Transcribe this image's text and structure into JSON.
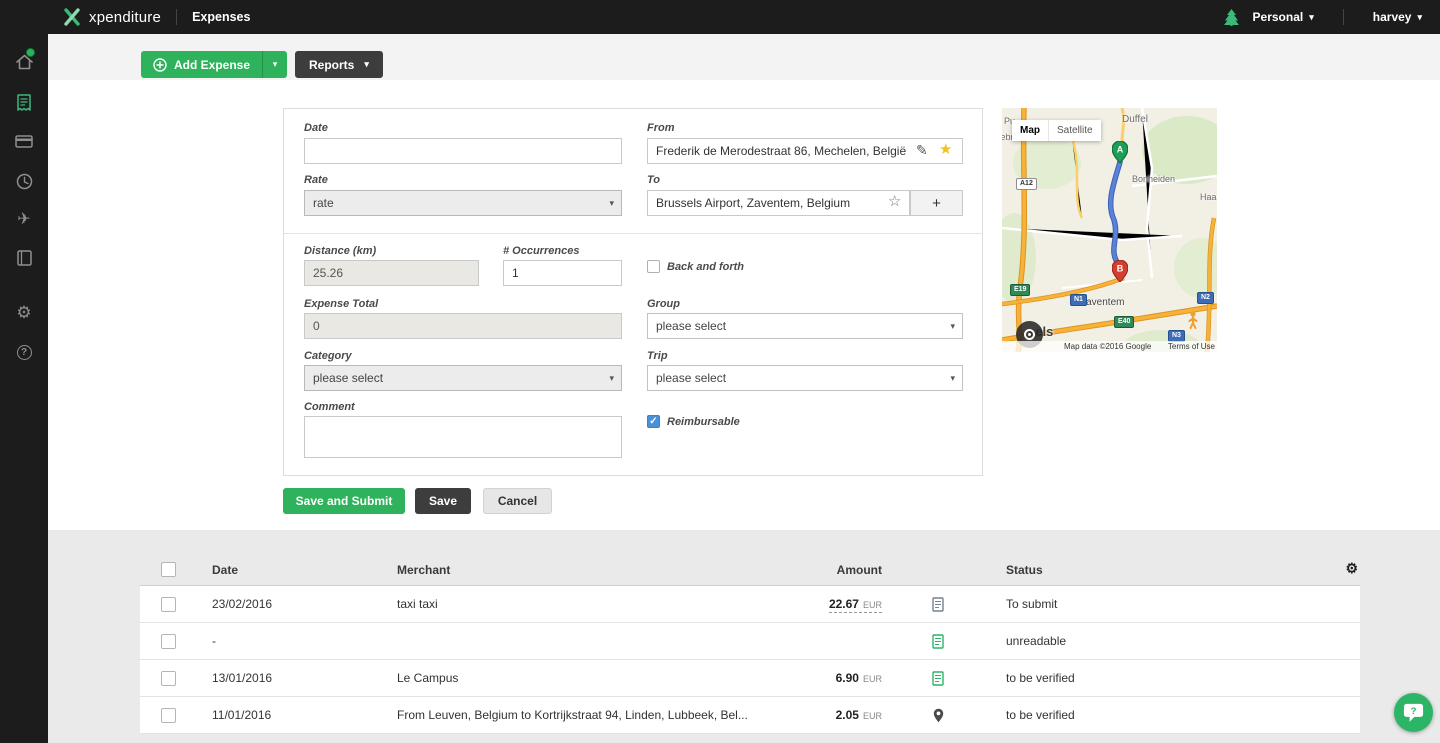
{
  "topbar": {
    "brand": "xpenditure",
    "page_title": "Expenses",
    "workspace": "Personal",
    "username": "harvey"
  },
  "toolbar": {
    "add_expense_label": "Add Expense",
    "reports_label": "Reports",
    "search_value": ""
  },
  "form": {
    "date": {
      "label": "Date",
      "value": ""
    },
    "rate": {
      "label": "Rate",
      "value": "rate"
    },
    "from": {
      "label": "From",
      "value": "Frederik de Merodestraat 86, Mechelen, België"
    },
    "to": {
      "label": "To",
      "value": "Brussels Airport, Zaventem, Belgium"
    },
    "distance": {
      "label": "Distance (km)",
      "value": "25.26"
    },
    "occurrences": {
      "label": "# Occurrences",
      "value": "1"
    },
    "back_and_forth": {
      "label": "Back and forth",
      "checked": false
    },
    "expense_total": {
      "label": "Expense Total",
      "value": "0"
    },
    "group": {
      "label": "Group",
      "value": "please select"
    },
    "category": {
      "label": "Category",
      "value": "please select"
    },
    "trip": {
      "label": "Trip",
      "value": "please select"
    },
    "comment": {
      "label": "Comment",
      "value": ""
    },
    "reimbursable": {
      "label": "Reimbursable",
      "checked": true
    },
    "buttons": {
      "save_submit": "Save and Submit",
      "save": "Save",
      "cancel": "Cancel"
    }
  },
  "map": {
    "control_map": "Map",
    "control_satellite": "Satellite",
    "marker_a": "A",
    "marker_b": "B",
    "places": {
      "puurs": "Pu",
      "willebroek": "Willebroek",
      "duffel": "Duffel",
      "bonheiden": "Bonheiden",
      "haacht": "Haac",
      "zaventem": "Zaventem",
      "brussels": "sels"
    },
    "roads": {
      "a12": "A12",
      "e19": "E19",
      "n1": "N1",
      "n2": "N2",
      "n3": "N3",
      "e40": "E40"
    },
    "attribution": "Map data ©2016 Google",
    "terms": "Terms of Use"
  },
  "table": {
    "headers": {
      "date": "Date",
      "merchant": "Merchant",
      "amount": "Amount",
      "status": "Status"
    },
    "rows": [
      {
        "date": "23/02/2016",
        "merchant": "taxi taxi",
        "amount": "22.67",
        "currency": "EUR",
        "icon": "receipt",
        "status": "To submit"
      },
      {
        "date": "-",
        "merchant": "",
        "amount": "",
        "currency": "",
        "icon": "receipt-green",
        "status": "unreadable"
      },
      {
        "date": "13/01/2016",
        "merchant": "Le Campus",
        "amount": "6.90",
        "currency": "EUR",
        "icon": "receipt-green",
        "status": "to be verified"
      },
      {
        "date": "11/01/2016",
        "merchant": "From Leuven, Belgium to Kortrijkstraat 94, Linden, Lubbeek, Bel...",
        "amount": "2.05",
        "currency": "EUR",
        "icon": "location-pin",
        "status": "to be verified"
      }
    ]
  },
  "icons": {
    "caret_down": "▾",
    "gear": "⚙",
    "plane": "✈",
    "star_filled": "★",
    "star_outline": "☆",
    "pencil": "✎",
    "plus": "+",
    "check": "✓",
    "question": "?"
  },
  "colors": {
    "accent_green": "#2fb25c",
    "dark_button": "#3d3d3d",
    "topbar": "#1c1c1c",
    "checked_blue": "#4a90d9",
    "star_yellow": "#f0c419",
    "route_blue": "#5a82d8"
  }
}
